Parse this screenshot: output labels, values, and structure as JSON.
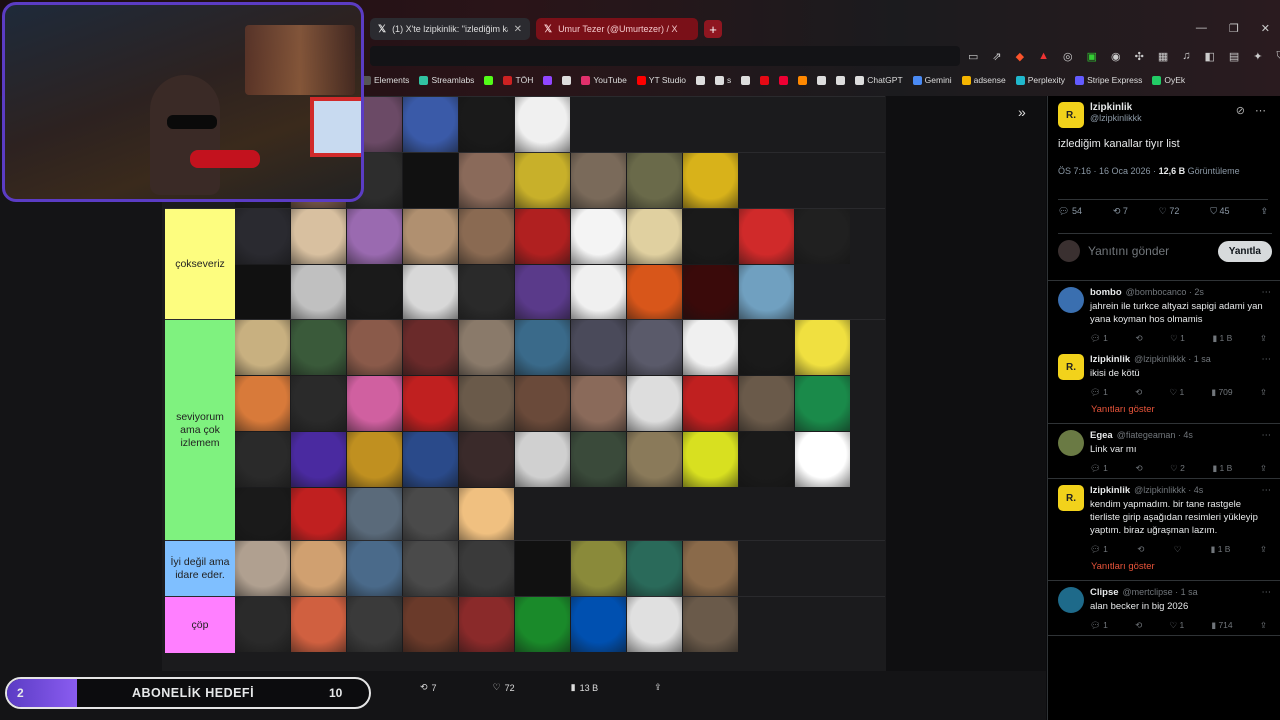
{
  "browser": {
    "tabs": [
      {
        "label": "(1) X'te lzipkinlik: \"izlediğim kanal",
        "active": true
      },
      {
        "label": "Umur Tezer (@Umurtezer) / X",
        "active": false
      }
    ],
    "bookmarks": [
      {
        "label": "Elements",
        "color": "#555"
      },
      {
        "label": "Streamlabs",
        "color": "#31c3a2"
      },
      {
        "label": "",
        "color": "#53fc18"
      },
      {
        "label": "TÖH",
        "color": "#c22"
      },
      {
        "label": "",
        "color": "#9146ff"
      },
      {
        "label": "",
        "color": "#ddd"
      },
      {
        "label": "YouTube",
        "color": "#e1306c"
      },
      {
        "label": "YT Studio",
        "color": "#f00"
      },
      {
        "label": "",
        "color": "#ddd"
      },
      {
        "label": "s",
        "color": "#ddd"
      },
      {
        "label": "",
        "color": "#ddd"
      },
      {
        "label": "",
        "color": "#e50914"
      },
      {
        "label": "",
        "color": "#e03"
      },
      {
        "label": "",
        "color": "#f80"
      },
      {
        "label": "",
        "color": "#ddd"
      },
      {
        "label": "",
        "color": "#ddd"
      },
      {
        "label": "ChatGPT",
        "color": "#ddd"
      },
      {
        "label": "Gemini",
        "color": "#4a8af4"
      },
      {
        "label": "adsense",
        "color": "#f4b400"
      },
      {
        "label": "Perplexity",
        "color": "#20b8cd"
      },
      {
        "label": "Stripe Express",
        "color": "#635bff"
      },
      {
        "label": "OyEk",
        "color": "#2c6"
      }
    ]
  },
  "tierlist": {
    "tiers": [
      {
        "label": "",
        "color": "#1b1b1d",
        "cells": [
          "#6b4a66",
          "#3a5aa8",
          "#1a1a1a",
          "#f0f0f0"
        ]
      },
      {
        "label": "",
        "color": "#1b1b1d",
        "cells": [
          "#1a1a1a",
          "#7a5a4a",
          "#2d2d2d",
          "#111",
          "#8a6a5a",
          "#c8b02a",
          "#7a6a5a",
          "#6a6a4a",
          "#d8b21a"
        ]
      },
      {
        "label": "çokseveriz",
        "color": "#fdfd7f",
        "cells": [
          "#2a2a30",
          "#d8c0a0",
          "#9a6ab0",
          "#b09070",
          "#8a6a52",
          "#b02020",
          "#f4f4f4",
          "#e0d0a0",
          "#1a1a1a",
          "#d02a2a",
          "#202020",
          "#111",
          "#c0c0c0",
          "#1a1a1a",
          "#d8d8d8",
          "#2a2a2a",
          "#5a3a8a",
          "#f0f0f0",
          "#d8561a",
          "#3a0a0a",
          "#70a0c0"
        ]
      },
      {
        "label": "seviyorum ama çok izlemem",
        "color": "#7ff27f",
        "cells": [
          "#c8b080",
          "#3a5a3a",
          "#8a5a4a",
          "#6a2a2a",
          "#8a7a6a",
          "#3a6a8a",
          "#4a4a5a",
          "#5a5a6a",
          "#f0f0f0",
          "#1a1a1a",
          "#f0e040",
          "#d87a3a",
          "#2a2a2a",
          "#d060a0",
          "#c02020",
          "#6a5a4a",
          "#6a4a3a",
          "#8a6a5a",
          "#ddd",
          "#c02020",
          "#6a5a4a",
          "#1a8a4a",
          "#2a2a2a",
          "#4a2aa0",
          "#c09020",
          "#2a4a8a",
          "#3a2a2a",
          "#d0d0d0",
          "#3a4a3a",
          "#8a7a5a",
          "#d8e020",
          "#1a1a1a",
          "#ffffff",
          "#1a1a1a",
          "#c02020",
          "#5a6a7a",
          "#4a4a4a",
          "#f0c080"
        ]
      },
      {
        "label": "İyi değil ama idare eder.",
        "color": "#7fbfff",
        "cells": [
          "#b0a090",
          "#d0a070",
          "#4a6a8a",
          "#4a4a4a",
          "#3a3a3a",
          "#111",
          "#8a8a3a",
          "#2a6a5a",
          "#8a6a4a"
        ]
      },
      {
        "label": "çöp",
        "color": "#ff7fff",
        "cells": [
          "#2a2a2a",
          "#d06040",
          "#3a3a3a",
          "#6a3a2a",
          "#8a2a2a",
          "#1a8a2a",
          "#0050b0",
          "#e0e0e0",
          "#6a5a4a"
        ]
      }
    ]
  },
  "stream": {
    "sub_goal_current": "2",
    "sub_goal_label": "ABONELİK HEDEFİ",
    "sub_goal_max": "10"
  },
  "bottom_actions": {
    "retweets": "7",
    "likes": "72",
    "views": "13 B"
  },
  "post": {
    "name": "lzipkinlik",
    "handle": "@lzipkinlikkk",
    "text": "izlediğim kanallar tiyır list",
    "time": "ÖS 7:16 · 16 Oca 2026 ·",
    "views_count": "12,6 B",
    "views_label": "Görüntüleme",
    "replies": "54",
    "retweets": "7",
    "likes": "72",
    "bookmarks": "45",
    "reply_placeholder": "Yanıtını gönder",
    "reply_button": "Yanıtla"
  },
  "replies": [
    {
      "name": "bombo",
      "handle": "@bombocanco · 2s",
      "text": "jahrein ile turkce altyazi sapigi adami yan yana koyman hos olmamis",
      "replies": "1",
      "retweets": "",
      "likes": "1",
      "views": "1 B",
      "avatar": "blue"
    },
    {
      "name": "lzipkinlik",
      "handle": "@lzipkinlikkk · 1 sa",
      "text": "ikisi de kötü",
      "replies": "1",
      "retweets": "",
      "likes": "1",
      "views": "709",
      "avatar": "yellow",
      "show": "Yanıtları göster"
    },
    {
      "name": "Egea",
      "handle": "@fiategeaman · 4s",
      "text": "Link var mı",
      "replies": "1",
      "retweets": "",
      "likes": "2",
      "views": "1 B",
      "avatar": "green"
    },
    {
      "name": "lzipkinlik",
      "handle": "@lzipkinlikkk · 4s",
      "text": "kendim yapmadım. bir tane rastgele tierliste girip aşağıdan resimleri yükleyip yaptım. biraz uğraşman lazım.",
      "replies": "1",
      "retweets": "",
      "likes": "",
      "views": "1 B",
      "avatar": "yellow",
      "show": "Yanıtları göster"
    },
    {
      "name": "Clipse",
      "handle": "@mertclipse · 1 sa",
      "text": "alan becker in big 2026",
      "replies": "1",
      "retweets": "",
      "likes": "1",
      "views": "714",
      "avatar": "teal"
    }
  ],
  "colors": {
    "accent": "#e8543a",
    "stream_purple": "#5b3cc4"
  }
}
